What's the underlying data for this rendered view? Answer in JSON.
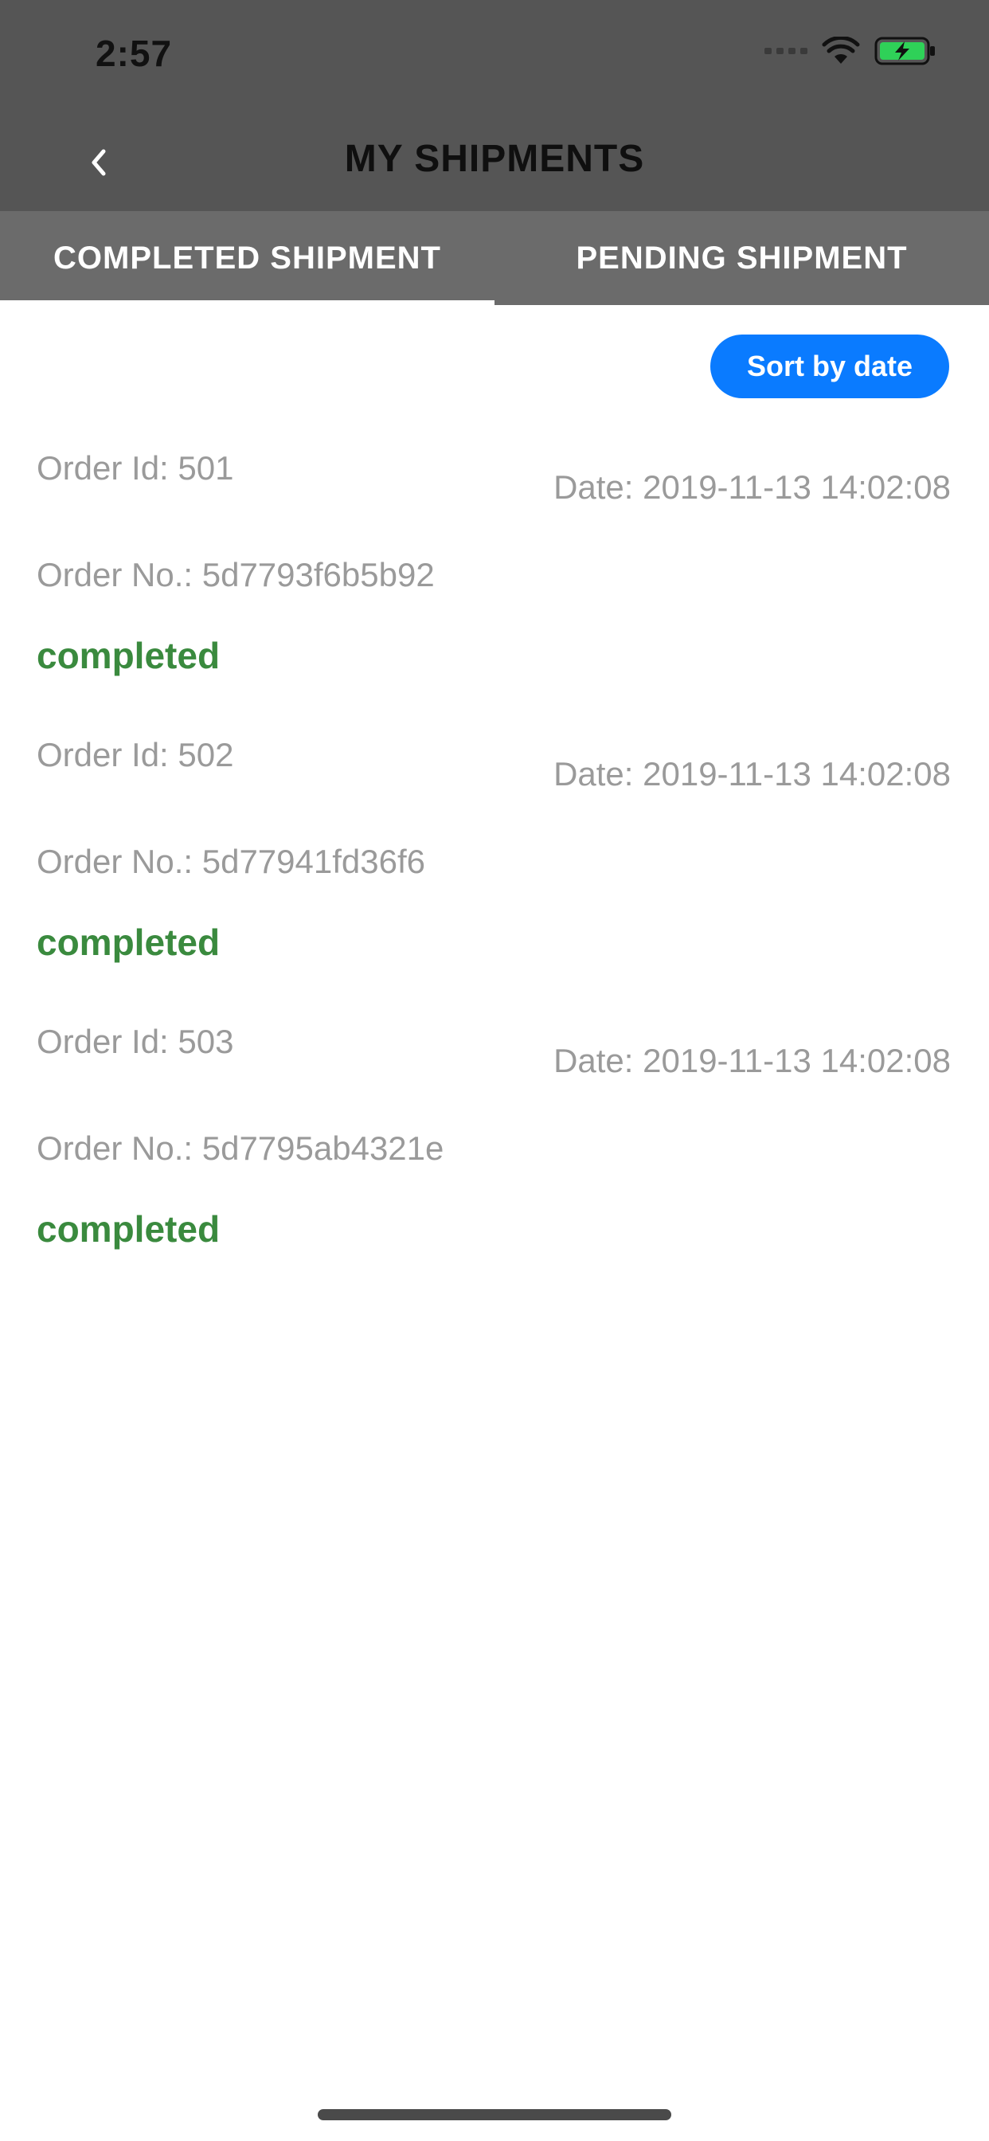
{
  "status_bar": {
    "time": "2:57"
  },
  "header": {
    "title": "MY SHIPMENTS"
  },
  "tabs": [
    {
      "label": "COMPLETED SHIPMENT",
      "active": true
    },
    {
      "label": "PENDING SHIPMENT",
      "active": false
    }
  ],
  "sort": {
    "label": "Sort by date"
  },
  "shipments": [
    {
      "order_id": "Order Id: 501",
      "date": "Date: 2019-11-13 14:02:08",
      "order_no": "Order No.: 5d7793f6b5b92",
      "status": "completed"
    },
    {
      "order_id": "Order Id: 502",
      "date": "Date: 2019-11-13 14:02:08",
      "order_no": "Order No.: 5d77941fd36f6",
      "status": "completed"
    },
    {
      "order_id": "Order Id: 503",
      "date": "Date: 2019-11-13 14:02:08",
      "order_no": "Order No.: 5d7795ab4321e",
      "status": "completed"
    }
  ],
  "icons": {
    "back": "chevron-left-icon",
    "wifi": "wifi-icon",
    "battery": "battery-charging-icon",
    "signal": "signal-icon"
  },
  "colors": {
    "header_bg": "#555555",
    "tab_bg": "#6b6b6b",
    "accent_blue": "#0a7bff",
    "status_green": "#3a8a3e",
    "muted_text": "#9a9a9a"
  }
}
